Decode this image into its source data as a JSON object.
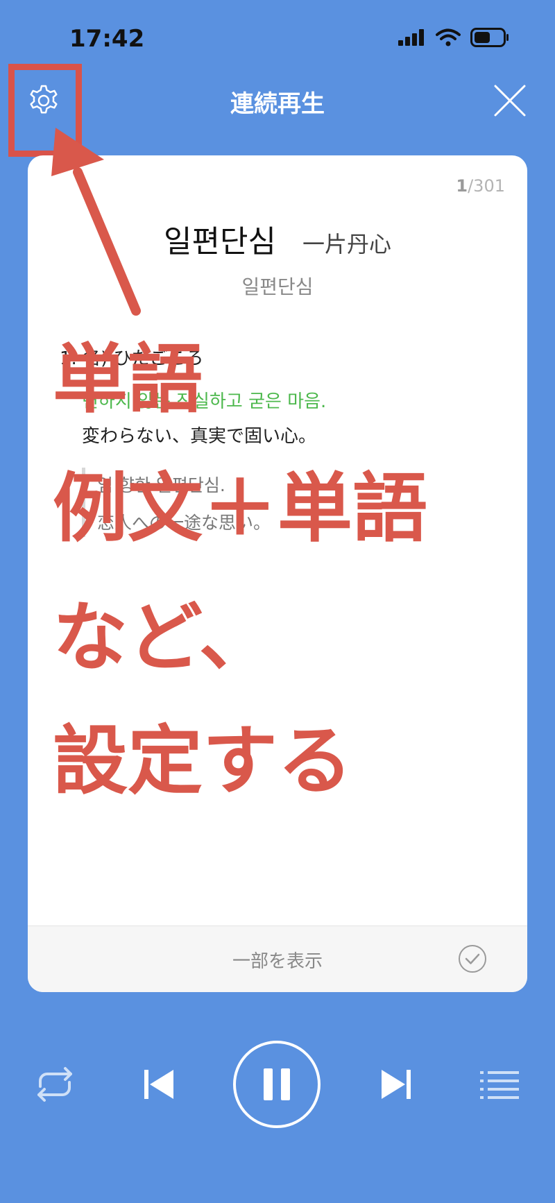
{
  "status_bar": {
    "time": "17:42"
  },
  "header": {
    "title": "連続再生"
  },
  "card": {
    "counter_current": "1",
    "counter_total": "/301",
    "word": "일편단심",
    "hanja": "一片丹心",
    "reading": "일편단심",
    "definition_number": "1. 名) ひたごころ",
    "definition_ko": "변하지 않는 진실하고 굳은 마음.",
    "definition_ja": "変わらない、真実で固い心。",
    "example_ko": "임 향한 일편단심.",
    "example_ja": "恋人への一途な思い。",
    "footer_label": "一部を表示"
  },
  "overlay": {
    "line1": "単語",
    "line2": "例文＋単語",
    "line3": "など、",
    "line4": "設定する"
  },
  "colors": {
    "background": "#5a91e0",
    "accent_red": "#d9584b",
    "definition_green": "#4cb84c"
  }
}
